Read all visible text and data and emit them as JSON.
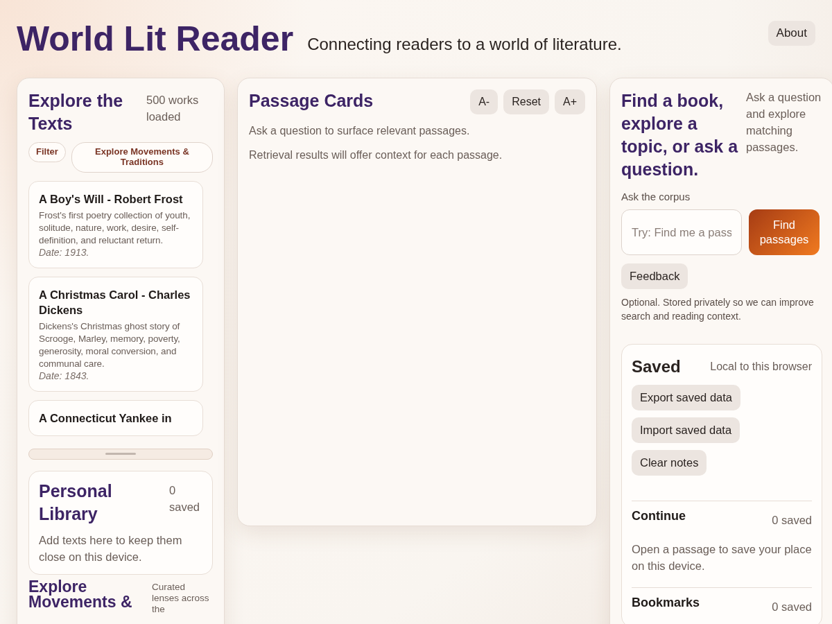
{
  "header": {
    "title": "World Lit Reader",
    "tagline": "Connecting readers to a world of literature.",
    "about_button": "About"
  },
  "explore": {
    "title": "Explore the Texts",
    "count": "500 works loaded",
    "chips": [
      "Filter",
      "Explore Movements & Traditions"
    ],
    "works": [
      {
        "title": "A Boy's Will - Robert Frost",
        "summary": "Frost's first poetry collection of youth, solitude, nature, work, desire, self-definition, and reluctant return.",
        "date": "Date: 1913."
      },
      {
        "title": "A Christmas Carol - Charles Dickens",
        "summary": "Dickens's Christmas ghost story of Scrooge, Marley, memory, poverty, generosity, moral conversion, and communal care.",
        "date": "Date: 1843."
      },
      {
        "title": "A Connecticut Yankee in"
      }
    ]
  },
  "personal_library": {
    "title": "Personal Library",
    "count": "0 saved",
    "note": "Add texts here to keep them close on this device."
  },
  "movements": {
    "title": "Explore Movements &",
    "note": "Curated lenses across the"
  },
  "passages": {
    "title": "Passage Cards",
    "font_buttons": [
      "A-",
      "Reset",
      "A+"
    ],
    "lines": [
      "Ask a question to surface relevant passages.",
      "Retrieval results will offer context for each passage."
    ]
  },
  "search": {
    "title": "Find a book, explore a topic, or ask a question.",
    "hint": "Ask a question and explore matching passages.",
    "label": "Ask the corpus",
    "placeholder": "Try: Find me a pass",
    "submit": "Find passages",
    "feedback_button": "Feedback",
    "feedback_note": "Optional. Stored privately so we can improve search and reading context."
  },
  "saved": {
    "title": "Saved",
    "scope": "Local to this browser",
    "actions": [
      "Export saved data",
      "Import saved data",
      "Clear notes"
    ],
    "sections": [
      {
        "title": "Continue",
        "count": "0 saved",
        "note": "Open a passage to save your place on this device."
      },
      {
        "title": "Bookmarks",
        "count": "0 saved"
      }
    ]
  }
}
